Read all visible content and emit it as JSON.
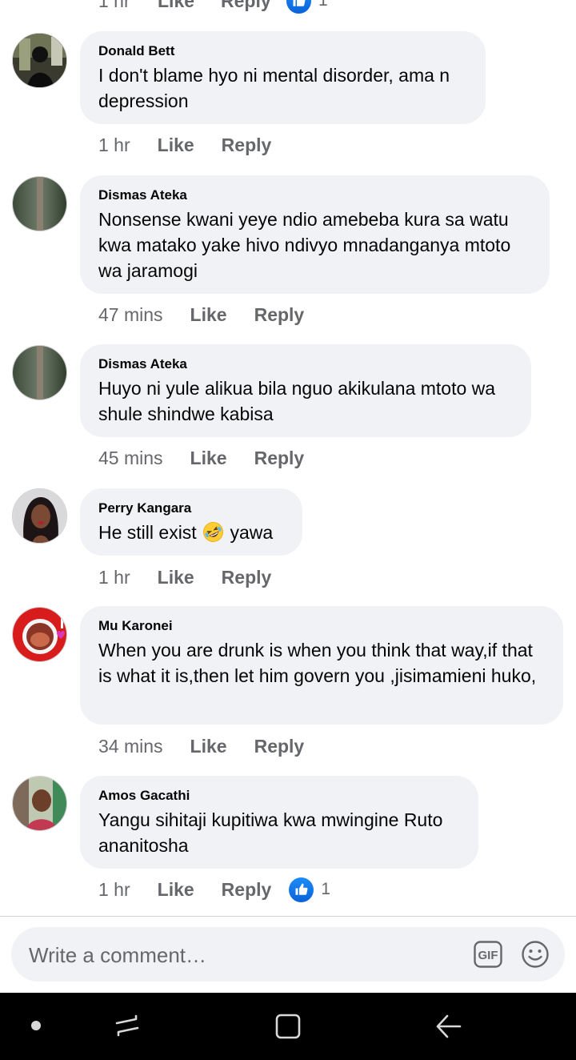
{
  "top_partial": {
    "time": "1 hr",
    "like": "Like",
    "reply": "Reply",
    "reaction_count": "1"
  },
  "comments": [
    {
      "author": "Donald Bett",
      "text": "I don't blame hyo ni mental disorder, ama n depression",
      "time": "1 hr",
      "like": "Like",
      "reply": "Reply"
    },
    {
      "author": "Dismas Ateka",
      "text": "Nonsense kwani yeye ndio amebeba kura sa watu kwa matako yake hivo ndivyo mnadanganya mtoto wa jaramogi",
      "time": "47 mins",
      "like": "Like",
      "reply": "Reply"
    },
    {
      "author": "Dismas Ateka",
      "text": "Huyo ni yule alikua bila nguo akikulana mtoto wa shule shindwe kabisa",
      "time": "45 mins",
      "like": "Like",
      "reply": "Reply"
    },
    {
      "author": "Perry Kangara",
      "text_before": "He still exist",
      "emoji": "rolling-on-floor-laughing-emoji",
      "text_after": "yawa",
      "time": "1 hr",
      "like": "Like",
      "reply": "Reply"
    },
    {
      "author": "Mu Karonei",
      "text": "When you are drunk is when you think that way,if that is what it is,then let him govern you ,jisimamieni huko,",
      "time": "34 mins",
      "like": "Like",
      "reply": "Reply"
    },
    {
      "author": "Amos Gacathi",
      "text": "Yangu sihitaji kupitiwa kwa mwingine Ruto ananitosha",
      "time": "1 hr",
      "like": "Like",
      "reply": "Reply",
      "reaction_count": "1"
    }
  ],
  "composer": {
    "placeholder": "Write a comment…",
    "gif_icon": "gif-icon",
    "emoji_icon": "smiley-icon"
  },
  "colors": {
    "bubble": "#f0f2f5",
    "meta_text": "#65676b",
    "like_blue": "#1877f2",
    "navbar": "#000000"
  }
}
